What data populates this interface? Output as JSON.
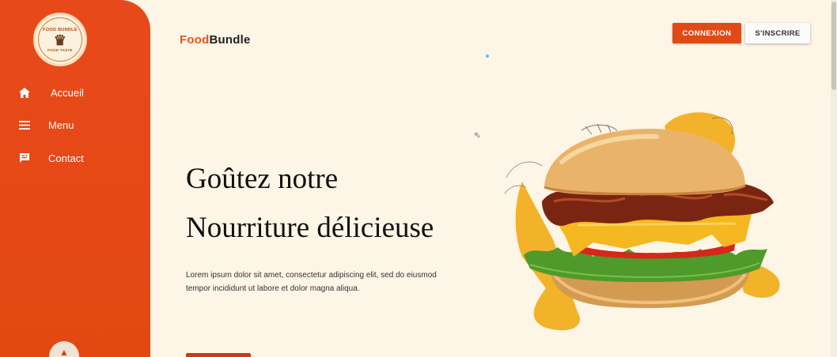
{
  "sidebar": {
    "logo": {
      "line1": "FOOD BUNDLE",
      "line2": "FOOD TASTE",
      "icon": "chef-icon"
    },
    "items": [
      {
        "label": "Accueil",
        "icon": "home-icon"
      },
      {
        "label": "Menu",
        "icon": "menu-icon"
      },
      {
        "label": "Contact",
        "icon": "contact-icon"
      }
    ]
  },
  "header": {
    "brand_part1": "Food",
    "brand_part2": "Bundle",
    "login_label": "CONNEXION",
    "signup_label": "S'INSCRIRE"
  },
  "hero": {
    "title_line1": "Goûtez notre",
    "title_line2": "Nourriture délicieuse",
    "text_line1": "Lorem ipsum dolor sit amet, consectetur adipiscing elit, sed do eiusmod",
    "text_line2": "tempor incididunt ut labore et dolor magna aliqua."
  },
  "colors": {
    "accent": "#e04a17",
    "sidebar": "#e8491a",
    "background": "#fdf5e6",
    "blob": "#f2b32a"
  }
}
